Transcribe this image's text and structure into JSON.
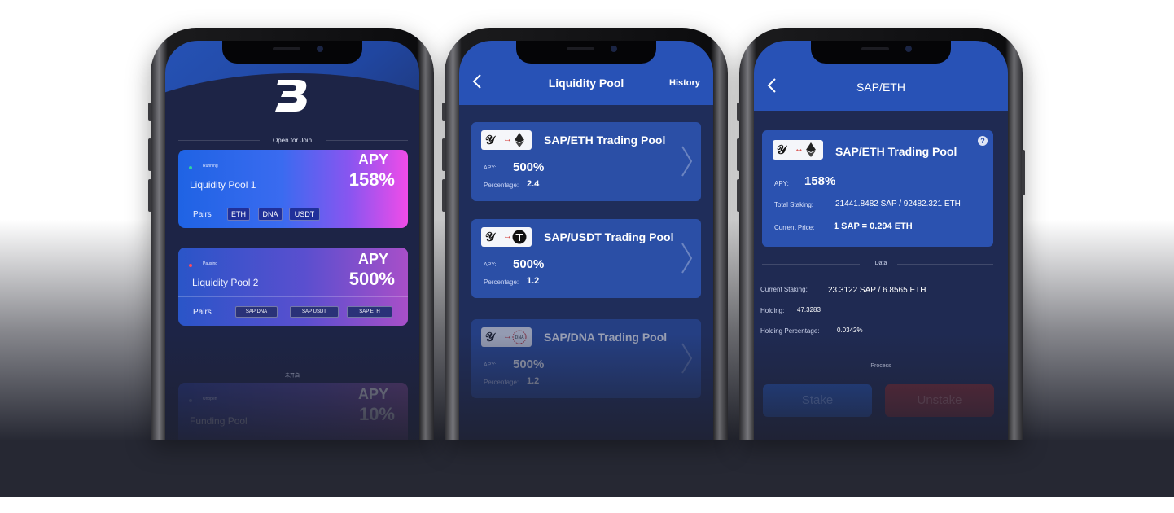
{
  "phone1": {
    "open_for_join": "Open for Join",
    "pools": [
      {
        "status": "Running",
        "name": "Liquidity Pool 1",
        "apy_label": "APY",
        "apy": "158%",
        "pairs_label": "Pairs",
        "pairs": [
          "ETH",
          "DNA",
          "USDT"
        ],
        "status_color": "#2fd3a0"
      },
      {
        "status": "Pausing",
        "name": "Liquidity Pool 2",
        "apy_label": "APY",
        "apy": "500%",
        "pairs_label": "Pairs",
        "pairs": [
          "SAP  DNA",
          "SAP  USDT",
          "SAP  ETH"
        ],
        "status_color": "#ff4a5a"
      },
      {
        "status": "Unopen",
        "name": "Funding Pool",
        "apy_label": "APY",
        "apy": "10%"
      }
    ],
    "not_open_label": "未开启"
  },
  "phone2": {
    "title": "Liquidity Pool",
    "history": "History",
    "pools": [
      {
        "name": "SAP/ETH Trading Pool",
        "apy_label": "APY:",
        "apy": "500%",
        "pct_label": "Percentage:",
        "pct": "2.4"
      },
      {
        "name": "SAP/USDT Trading Pool",
        "apy_label": "APY:",
        "apy": "500%",
        "pct_label": "Percentage:",
        "pct": "1.2"
      },
      {
        "name": "SAP/DNA Trading Pool",
        "apy_label": "APY:",
        "apy": "500%",
        "pct_label": "Percentage:",
        "pct": "1.2"
      }
    ]
  },
  "phone3": {
    "title": "SAP/ETH",
    "card": {
      "name": "SAP/ETH Trading Pool",
      "apy_label": "APY:",
      "apy": "158%",
      "total_label": "Total Staking:",
      "total": "21441.8482 SAP / 92482.321 ETH",
      "price_label": "Current Price:",
      "price": "1 SAP = 0.294 ETH"
    },
    "data_label": "Data",
    "current_staking_label": "Current Staking:",
    "current_staking": "23.3122 SAP / 6.8565 ETH",
    "holding_label": "Holding:",
    "holding": "47.3283",
    "holding_pct_label": "Holding Percentage:",
    "holding_pct": "0.0342%",
    "process_label": "Process",
    "stake": "Stake",
    "unstake": "Unstake"
  }
}
